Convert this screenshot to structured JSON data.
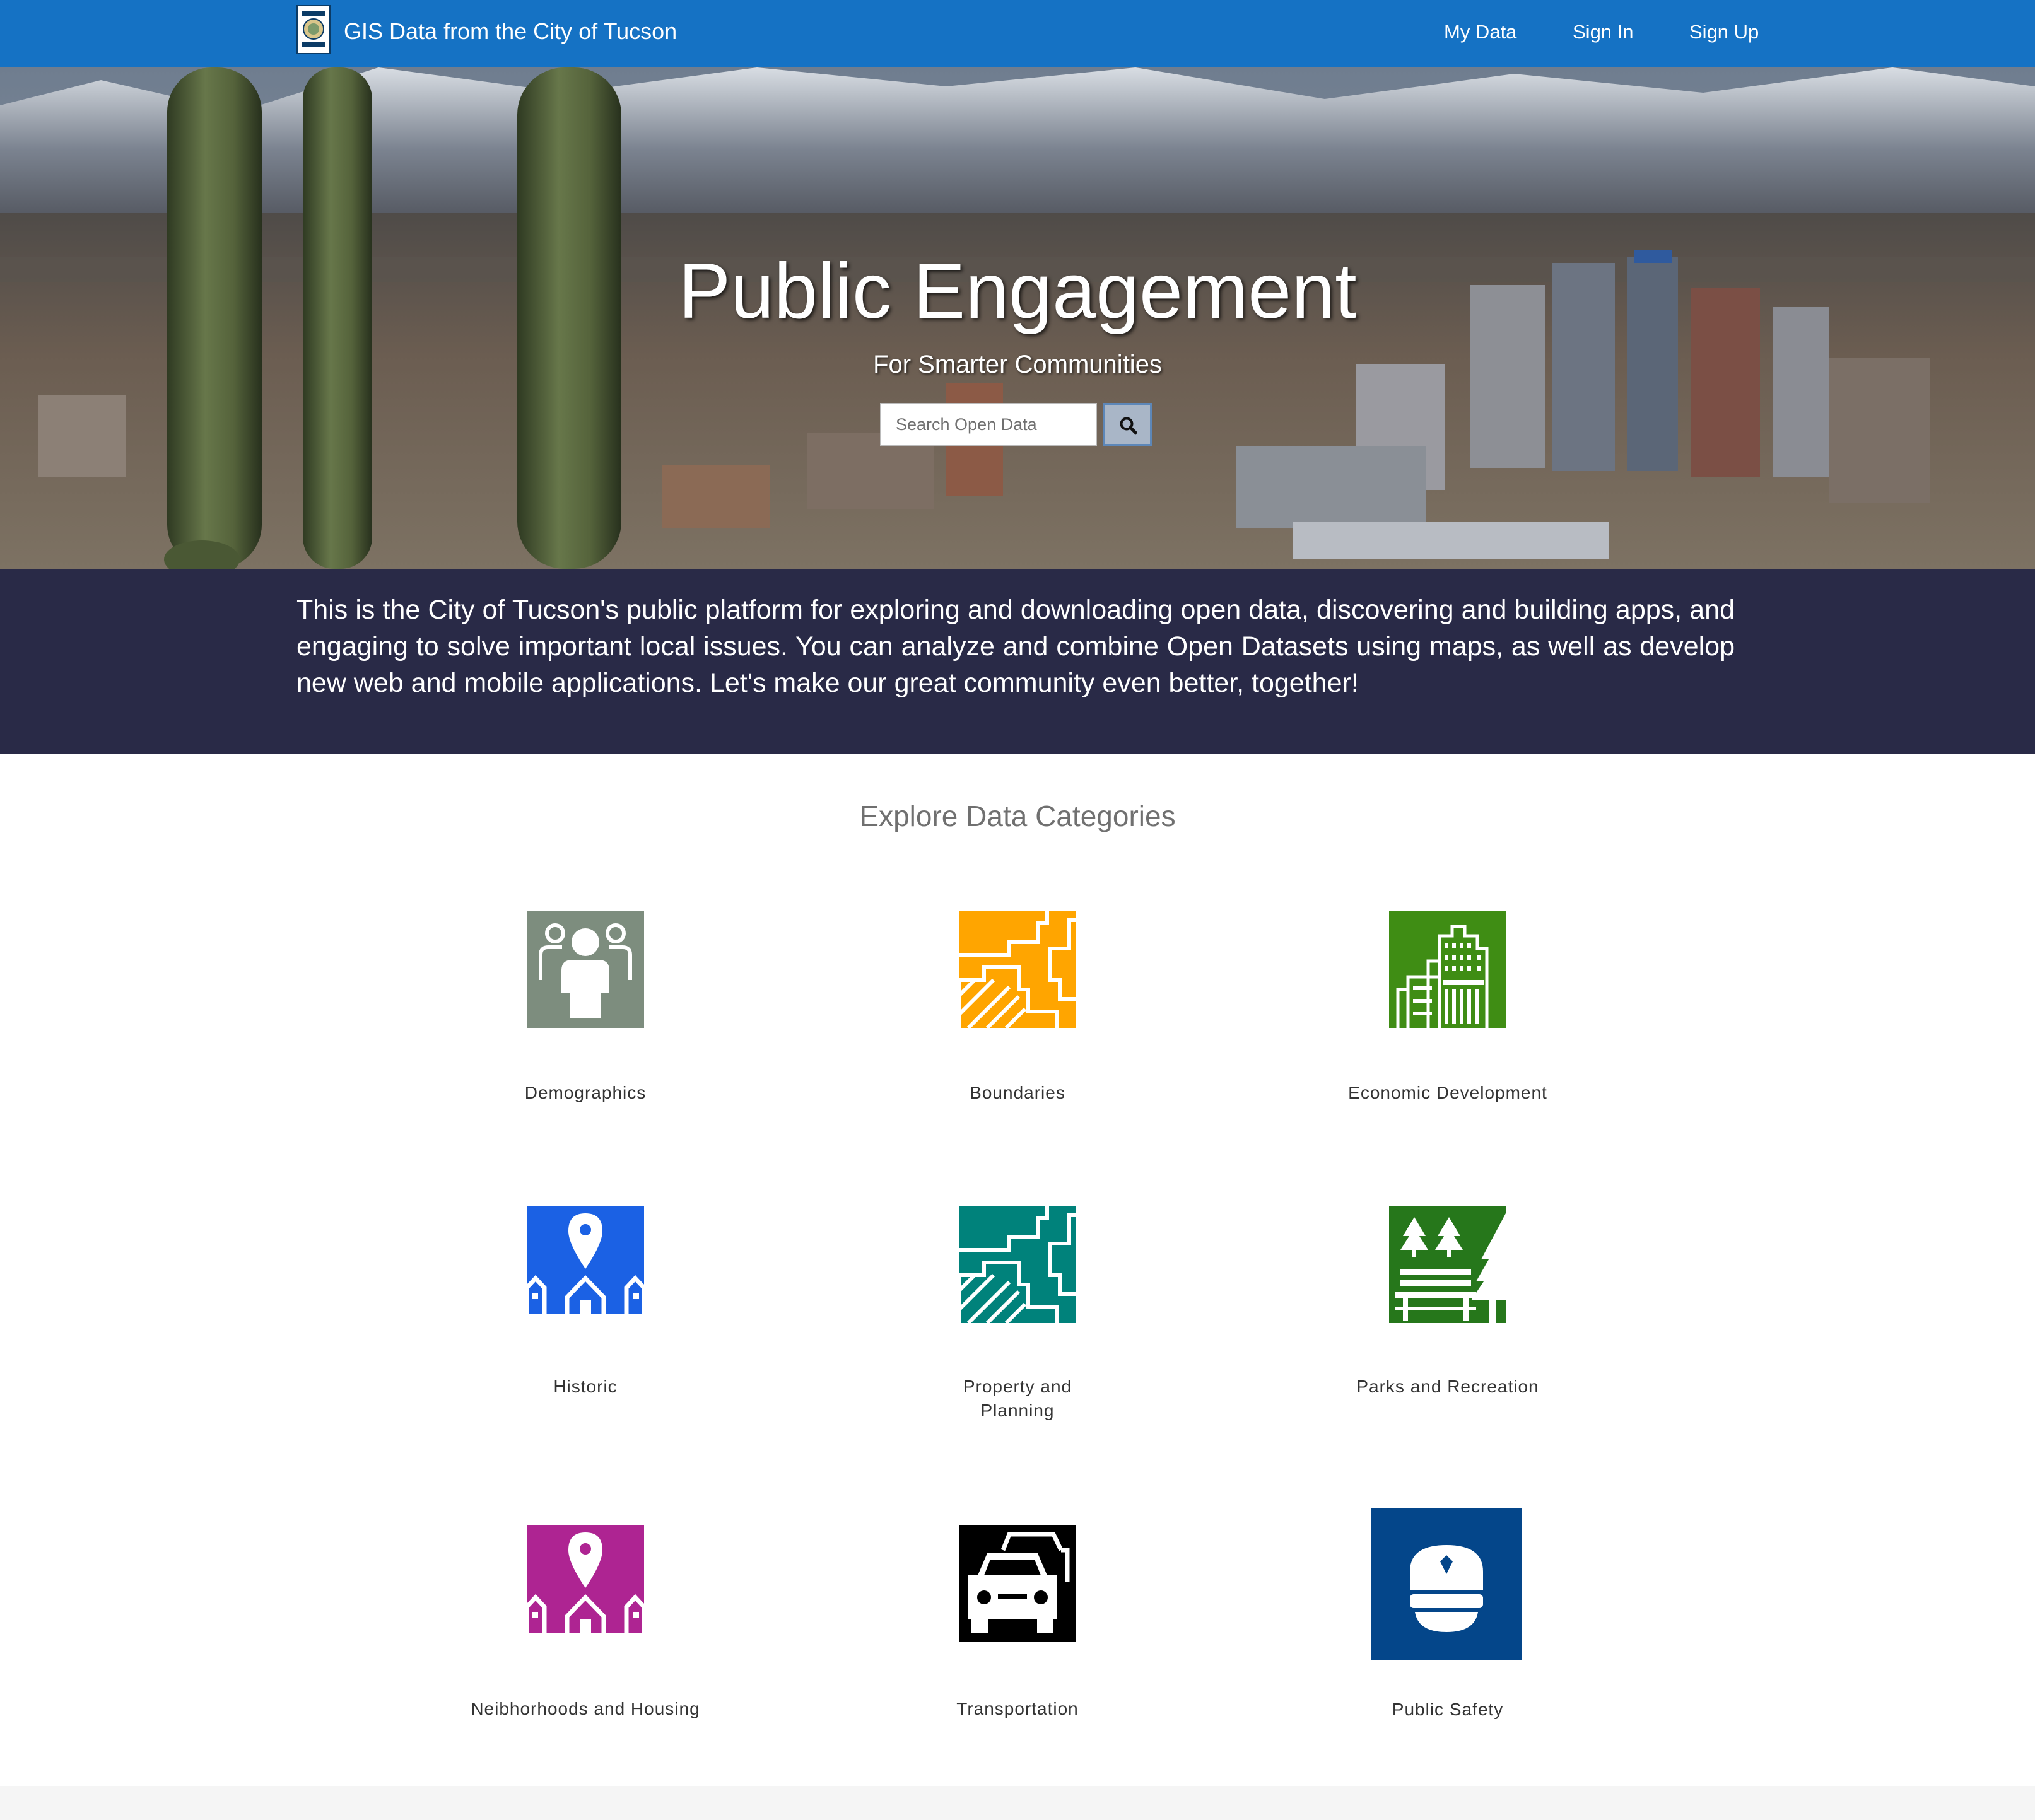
{
  "header": {
    "site_title": "GIS Data from the City of Tucson",
    "logo_text": "CITY OF TUCSON",
    "nav": {
      "my_data": "My Data",
      "sign_in": "Sign In",
      "sign_up": "Sign Up"
    },
    "color": "#1572c4"
  },
  "hero": {
    "title": "Public Engagement",
    "subtitle": "For Smarter Communities",
    "search": {
      "placeholder": "Search Open Data",
      "value": ""
    },
    "search_icon": "search-icon"
  },
  "intro": {
    "text": "This is the City of Tucson's public platform for exploring and downloading open data, discovering and building apps, and engaging to solve important local issues. You can analyze and combine Open Datasets using maps, as well as develop new web and mobile applications. Let's make our great community even better, together!",
    "background": "#292a47"
  },
  "categories": {
    "heading": "Explore Data Categories",
    "items": [
      {
        "label": "Demographics",
        "color": "#7d8d7e",
        "icon": "people-icon"
      },
      {
        "label": "Boundaries",
        "color": "#ffa500",
        "icon": "boundary-map-icon"
      },
      {
        "label": "Economic Development",
        "color": "#3f8d14",
        "icon": "building-icon"
      },
      {
        "label": "Historic",
        "color": "#1b61e4",
        "icon": "map-pin-houses-icon"
      },
      {
        "label": "Property and Planning",
        "color": "#00827b",
        "icon": "parcel-map-icon"
      },
      {
        "label": "Parks and Recreation",
        "color": "#26771b",
        "icon": "park-bench-trees-icon"
      },
      {
        "label": "Neibhorhoods and Housing",
        "color": "#ae2492",
        "icon": "map-pin-houses-icon"
      },
      {
        "label": "Transportation",
        "color": "#000000",
        "icon": "cars-icon"
      },
      {
        "label": "Public Safety",
        "color": "#04468a",
        "icon": "police-hat-icon"
      }
    ]
  }
}
